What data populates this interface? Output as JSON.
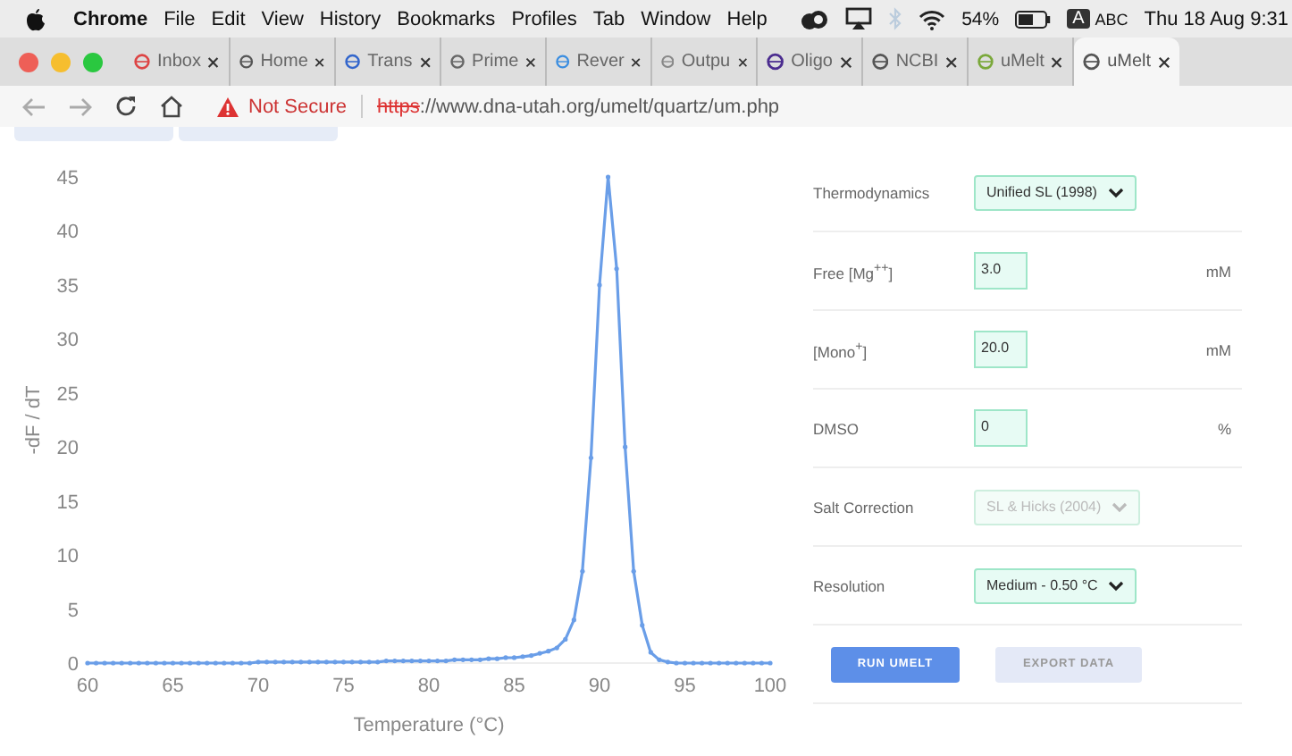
{
  "menu_bar": {
    "app": "Chrome",
    "items": [
      "File",
      "Edit",
      "View",
      "History",
      "Bookmarks",
      "Profiles",
      "Tab",
      "Window",
      "Help"
    ],
    "battery": "54%",
    "input_badge": "A",
    "input_source": "ABC",
    "clock": "Thu 18 Aug 9:31"
  },
  "tabs": [
    {
      "label": "Inbox",
      "selected": false
    },
    {
      "label": "Home",
      "selected": false
    },
    {
      "label": "Trans",
      "selected": false
    },
    {
      "label": "Prime",
      "selected": false
    },
    {
      "label": "Rever",
      "selected": false
    },
    {
      "label": "Outpu",
      "selected": false
    },
    {
      "label": "Oligo",
      "selected": false
    },
    {
      "label": "NCBI",
      "selected": false
    },
    {
      "label": "uMelt",
      "selected": false
    },
    {
      "label": "uMelt",
      "selected": true
    }
  ],
  "address_bar": {
    "security": "Not Secure",
    "url_scheme": "https",
    "url_rest": "://www.dna-utah.org/umelt/quartz/um.php"
  },
  "chart": {
    "chart_data": {
      "type": "line",
      "xlabel": "Temperature (°C)",
      "ylabel": "-dF / dT",
      "xlim": [
        60,
        100
      ],
      "ylim": [
        0,
        45
      ],
      "xticks": [
        60,
        65,
        70,
        75,
        80,
        85,
        90,
        95,
        100
      ],
      "yticks": [
        0,
        5,
        10,
        15,
        20,
        25,
        30,
        35,
        40,
        45
      ],
      "x": [
        60,
        60.5,
        61,
        61.5,
        62,
        62.5,
        63,
        63.5,
        64,
        64.5,
        65,
        65.5,
        66,
        66.5,
        67,
        67.5,
        68,
        68.5,
        69,
        69.5,
        70,
        70.5,
        71,
        71.5,
        72,
        72.5,
        73,
        73.5,
        74,
        74.5,
        75,
        75.5,
        76,
        76.5,
        77,
        77.5,
        78,
        78.5,
        79,
        79.5,
        80,
        80.5,
        81,
        81.5,
        82,
        82.5,
        83,
        83.5,
        84,
        84.5,
        85,
        85.5,
        86,
        86.5,
        87,
        87.5,
        88,
        88.5,
        89,
        89.5,
        90,
        90.5,
        91,
        91.5,
        92,
        92.5,
        93,
        93.5,
        94,
        94.5,
        95,
        95.5,
        96,
        96.5,
        97,
        97.5,
        98,
        98.5,
        99,
        99.5,
        100
      ],
      "series": [
        {
          "color": "#6a9ee8",
          "values": [
            0,
            0,
            0,
            0,
            0,
            0,
            0,
            0,
            0,
            0,
            0,
            0,
            0,
            0,
            0,
            0,
            0,
            0,
            0,
            0,
            0.1,
            0.1,
            0.1,
            0.1,
            0.1,
            0.1,
            0.1,
            0.1,
            0.1,
            0.1,
            0.1,
            0.1,
            0.1,
            0.1,
            0.1,
            0.2,
            0.2,
            0.2,
            0.2,
            0.2,
            0.2,
            0.2,
            0.2,
            0.3,
            0.3,
            0.3,
            0.3,
            0.4,
            0.4,
            0.5,
            0.5,
            0.6,
            0.7,
            0.9,
            1.1,
            1.4,
            2.2,
            4,
            8.5,
            19,
            35,
            45,
            36.5,
            20,
            8.5,
            3.5,
            1,
            0.3,
            0.1,
            0,
            0,
            0,
            0,
            0,
            0,
            0,
            0,
            0,
            0,
            0,
            0
          ]
        }
      ]
    }
  },
  "settings": [
    {
      "kind": "select",
      "label": "Thermodynamics",
      "value": "Unified SL (1998)",
      "disabled": false
    },
    {
      "kind": "input",
      "label": "Free [Mg$^{++}$]",
      "value": "3.0",
      "unit": "mM"
    },
    {
      "kind": "input",
      "label": "[Mono$^{+}$]",
      "value": "20.0",
      "unit": "mM"
    },
    {
      "kind": "input",
      "label": "DMSO",
      "value": "0",
      "unit": "%"
    },
    {
      "kind": "select",
      "label": "Salt Correction",
      "value": "SL & Hicks (2004)",
      "disabled": true
    },
    {
      "kind": "select",
      "label": "Resolution",
      "value": "Medium - 0.50 °C",
      "disabled": false
    }
  ],
  "buttons": [
    {
      "label": "RUN UMELT",
      "disabled": false
    },
    {
      "label": "EXPORT DATA",
      "disabled": true
    }
  ]
}
